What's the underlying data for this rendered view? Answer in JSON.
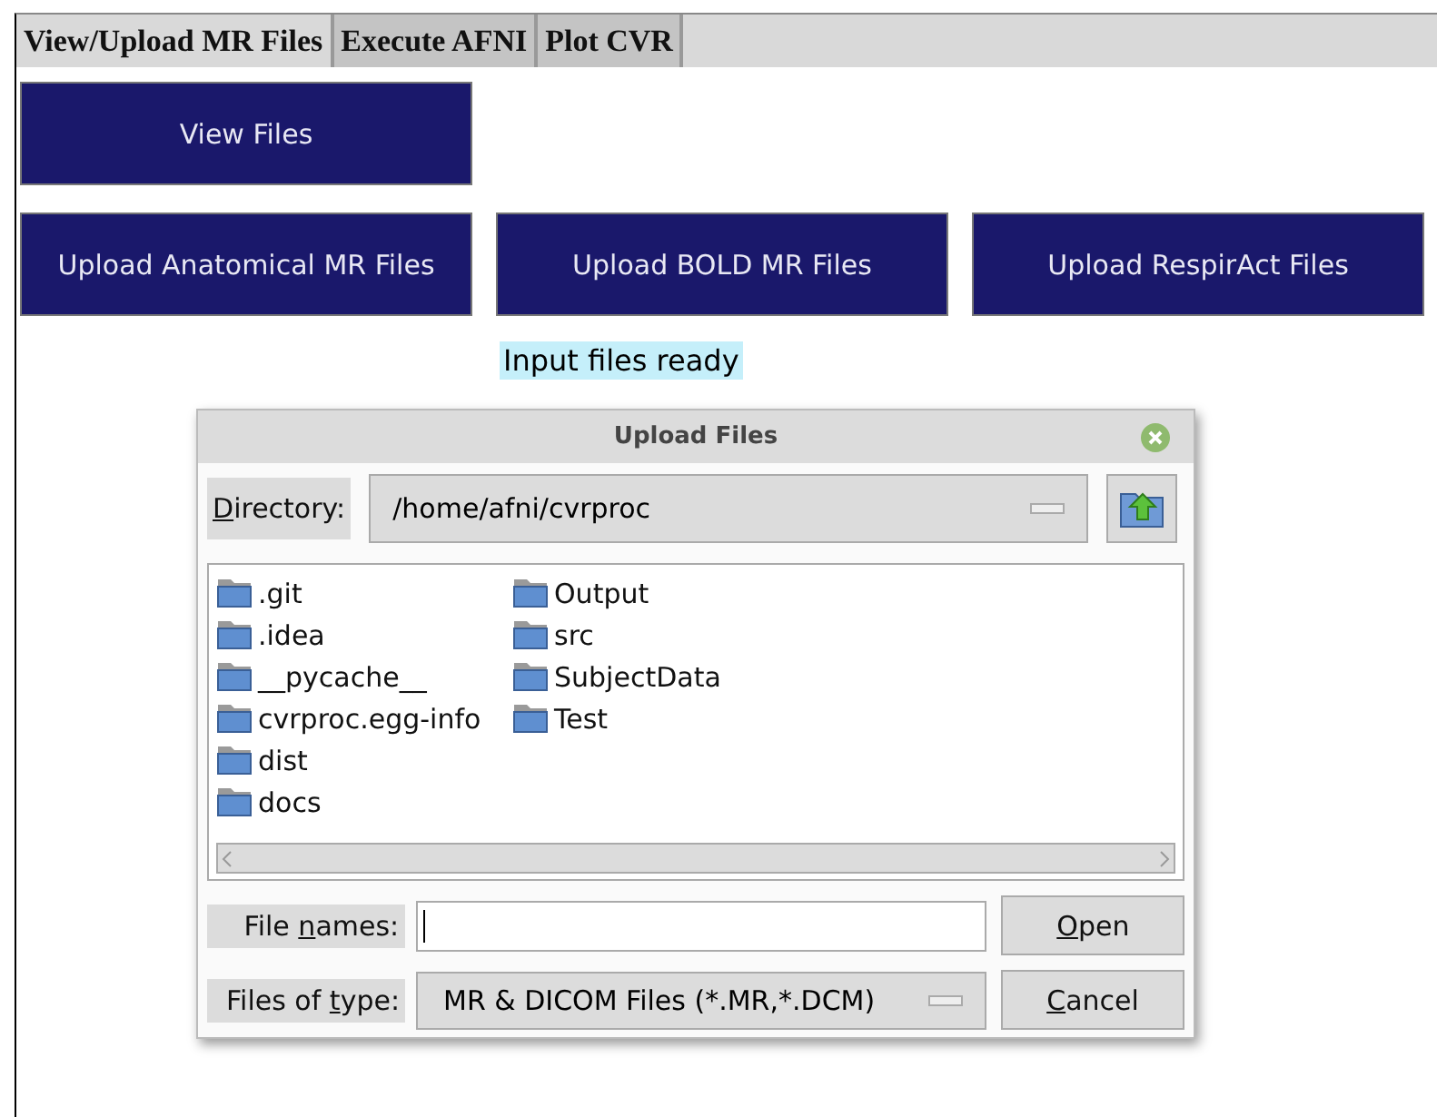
{
  "tabs": [
    {
      "label": "View/Upload MR Files",
      "selected": true
    },
    {
      "label": "Execute AFNI",
      "selected": false
    },
    {
      "label": "Plot CVR",
      "selected": false
    }
  ],
  "view_button": "View Files",
  "upload_buttons": [
    "Upload Anatomical MR Files",
    "Upload BOLD MR Files",
    "Upload RespirAct Files"
  ],
  "status_label": "Input files ready",
  "dialog": {
    "title": "Upload Files",
    "directory": {
      "label": {
        "key": "D",
        "post": "irectory:"
      },
      "value": "/home/afni/cvrproc"
    },
    "folders": [
      [
        ".git",
        ".idea",
        "__pycache__",
        "cvrproc.egg-info",
        "dist",
        "docs"
      ],
      [
        "Output",
        "src",
        "SubjectData",
        "Test"
      ]
    ],
    "file_names": {
      "label": {
        "pre": "File ",
        "key": "n",
        "post": "ames:"
      }
    },
    "file_type": {
      "label": {
        "pre": "Files of ",
        "key": "t",
        "post": "ype:"
      },
      "value": "MR & DICOM Files (*.MR,*.DCM)"
    },
    "buttons": [
      {
        "key": "O",
        "post": "pen"
      },
      {
        "key": "C",
        "post": "ancel"
      }
    ]
  }
}
